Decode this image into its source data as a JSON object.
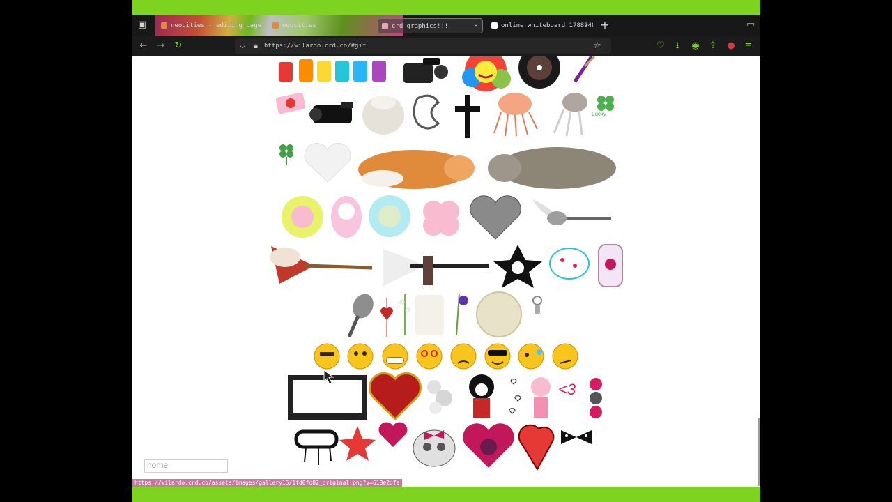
{
  "browser": {
    "tabs": [
      {
        "title": "neocities - editing page",
        "active": false
      },
      {
        "title": "neocities",
        "active": false
      },
      {
        "title": "crd graphics!!!",
        "active": true
      },
      {
        "title": "online whiteboard 1788948",
        "active": false
      }
    ],
    "new_tab": "+",
    "close": "×",
    "url": "https://wilardo.crd.co/#gif"
  },
  "page": {
    "nav_input_placeholder": "home",
    "status_url": "https://wilardo.crd.co/assets/images/gallery15/1fd0fd82_original.png?v=618e2dfe",
    "heart_text": "<3",
    "lucky_text": "Lucky"
  },
  "colors": {
    "accent": "#7ed321",
    "tab_bg": "#181818",
    "nav_bg": "#1b1b1b"
  },
  "icons": [
    "tab-manager-icon",
    "back-icon",
    "forward-icon",
    "reload-icon",
    "shield-icon",
    "lock-icon",
    "star-icon",
    "pocket-icon",
    "download-icon",
    "extension-icon",
    "share-icon",
    "profile-icon",
    "menu-icon",
    "folder-icon"
  ]
}
